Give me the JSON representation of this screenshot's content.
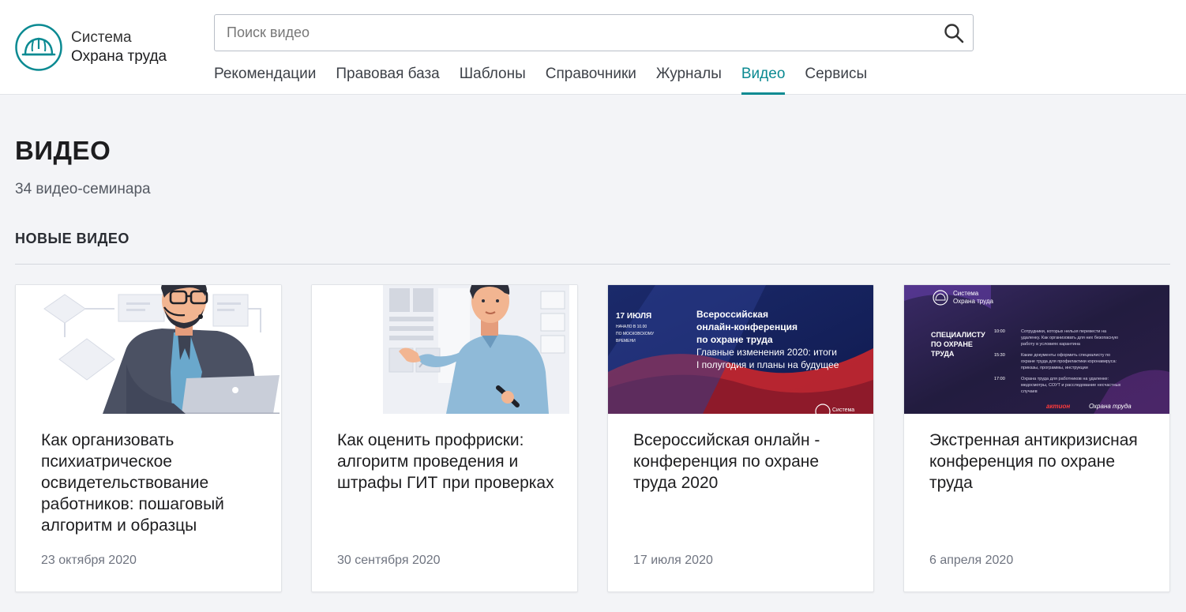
{
  "brand": {
    "line1": "Система",
    "line2": "Охрана труда"
  },
  "search": {
    "placeholder": "Поиск видео"
  },
  "nav": {
    "items": [
      {
        "label": "Рекомендации"
      },
      {
        "label": "Правовая база"
      },
      {
        "label": "Шаблоны"
      },
      {
        "label": "Справочники"
      },
      {
        "label": "Журналы"
      },
      {
        "label": "Видео",
        "active": true
      },
      {
        "label": "Сервисы"
      }
    ]
  },
  "page": {
    "title": "ВИДЕО",
    "subtitle": "34 видео-семинара",
    "section_title": "НОВЫЕ ВИДЕО"
  },
  "cards": [
    {
      "title": "Как организовать психиатрическое освидетельствование работников: пошаговый алгоритм и образцы",
      "date": "23 октября 2020"
    },
    {
      "title": "Как оценить профриски: алгоритм проведения и штрафы ГИТ при проверках",
      "date": "30 сентября 2020"
    },
    {
      "title": "Всероссийская онлайн - конференция по охране труда 2020",
      "date": "17 июля 2020",
      "thumb": {
        "date_big": "17 ИЮЛЯ",
        "time_line1": "НАЧАЛО В 10.00",
        "time_line2": "ПО МОСКОВСКОМУ",
        "time_line3": "ВРЕМЕНИ",
        "headline1": "Всероссийская",
        "headline2": "онлайн-конференция",
        "headline3": "по охране труда",
        "sub1": "Главные изменения 2020: итоги",
        "sub2": "I полугодия и планы на будущее",
        "brand": "Система"
      }
    },
    {
      "title": "Экстренная антикризисная конференция по охране труда",
      "date": "6 апреля 2020",
      "thumb": {
        "brand1": "Система",
        "brand2": "Охрана труда",
        "head1": "СПЕЦИАЛИСТУ",
        "head2": "ПО ОХРАНЕ",
        "head3": "ТРУДА",
        "t1": "10:00",
        "t1a": "Сотрудники, которых нельзя перевести на",
        "t1b": "удаленку. Как организовать для них безопасную",
        "t1c": "работу в условиях карантина",
        "t2": "15:30",
        "t2a": "Какие документы оформить специалисту по",
        "t2b": "охране труда для профилактики коронавируса:",
        "t2c": "приказы, программы, инструкции",
        "t3": "17:00",
        "t3a": "Охрана труда для работников на удаленке:",
        "t3b": "медосмотры, СОУТ и расследование несчастных",
        "t3c": "случаев",
        "footer_brand": "актион",
        "footer_text": "Охрана труда"
      }
    }
  ],
  "colors": {
    "accent": "#0b8a92",
    "background": "#f3f4f7",
    "card": "#ffffff"
  },
  "icons": {
    "search": "magnifier",
    "logo": "hard-hat"
  }
}
